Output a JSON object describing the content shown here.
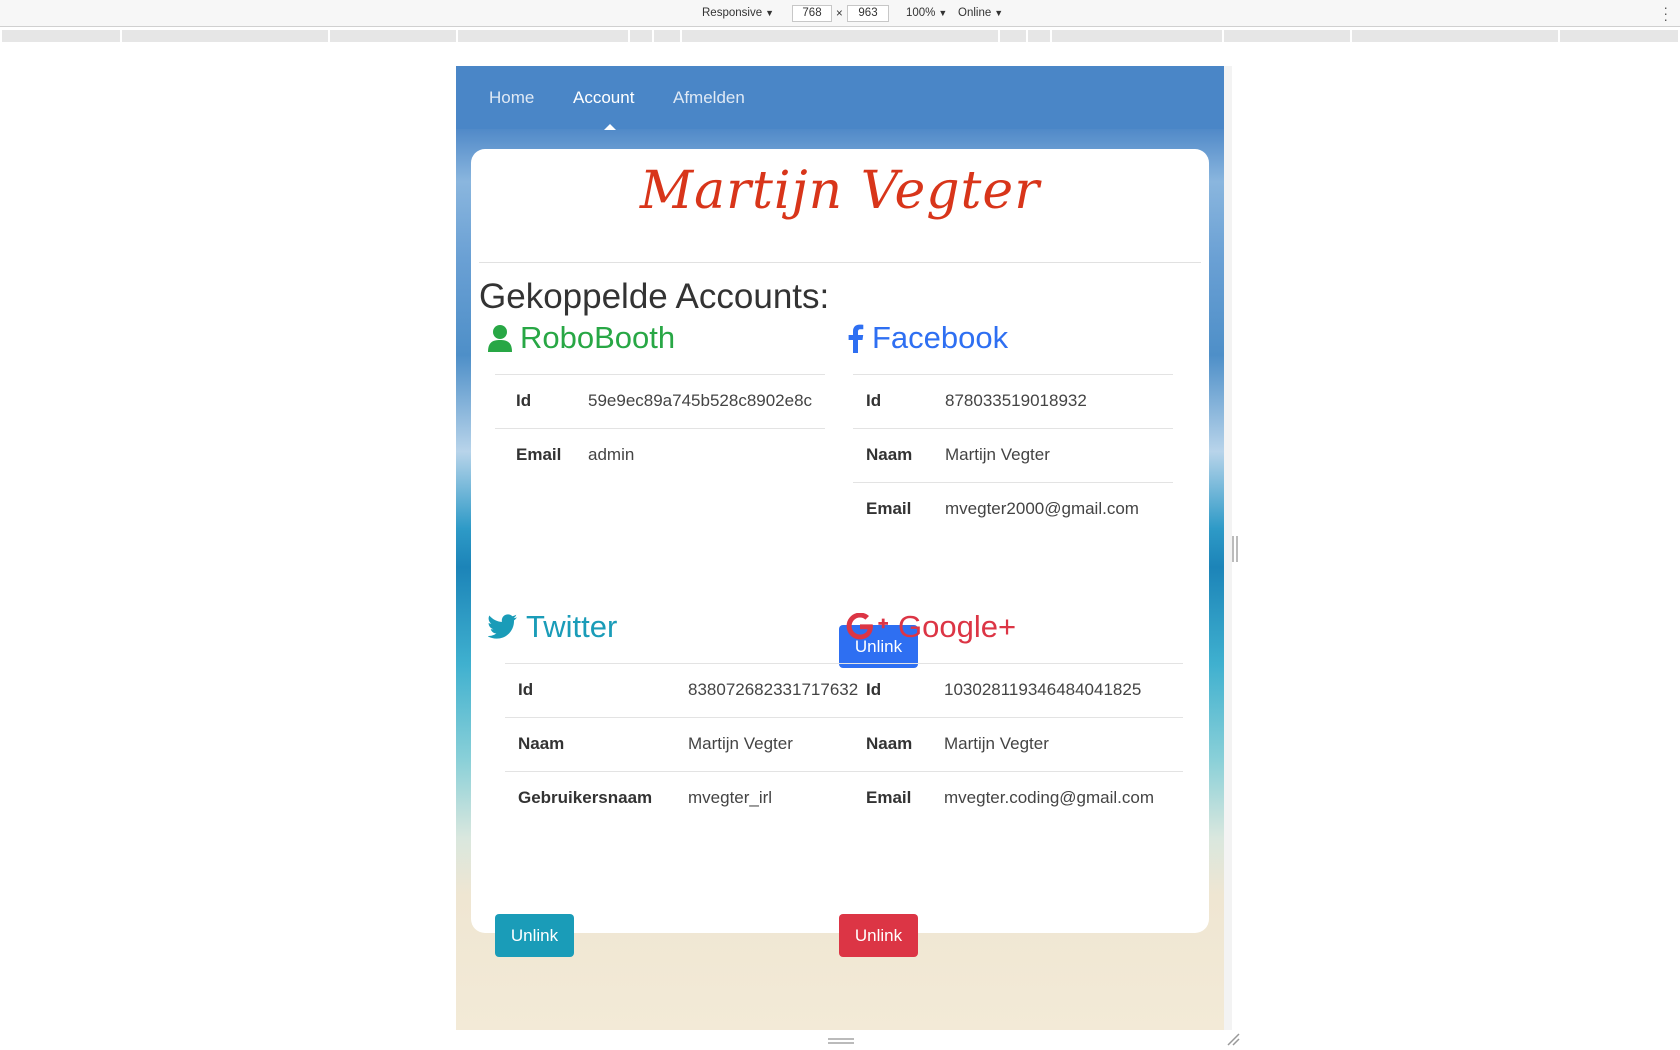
{
  "devtools": {
    "device": "Responsive",
    "width": "768",
    "times": "×",
    "height": "963",
    "zoom": "100%",
    "network": "Online"
  },
  "nav": {
    "items": [
      {
        "label": "Home",
        "active": false
      },
      {
        "label": "Account",
        "active": true
      },
      {
        "label": "Afmelden",
        "active": false
      }
    ]
  },
  "brand": "Martijn Vegter",
  "page_title": "Gekoppelde Accounts:",
  "colors": {
    "robobooth": "#28a745",
    "facebook": "#2e6ff2",
    "twitter": "#1a9cb8",
    "google": "#dc3545",
    "navbar": "#4a86c7",
    "brand": "#d8351a"
  },
  "accounts": {
    "robobooth": {
      "title": "RoboBooth",
      "icon": "user-icon",
      "rows": [
        {
          "key": "Id",
          "value": "59e9ec89a745b528c8902e8c"
        },
        {
          "key": "Email",
          "value": "admin"
        }
      ]
    },
    "facebook": {
      "title": "Facebook",
      "icon": "facebook-icon",
      "rows": [
        {
          "key": "Id",
          "value": "878033519018932"
        },
        {
          "key": "Naam",
          "value": "Martijn Vegter"
        },
        {
          "key": "Email",
          "value": "mvegter2000@gmail.com"
        }
      ],
      "button": "Unlink"
    },
    "twitter": {
      "title": "Twitter",
      "icon": "twitter-icon",
      "rows": [
        {
          "key": "Id",
          "value": "838072682331717632"
        },
        {
          "key": "Naam",
          "value": "Martijn Vegter"
        },
        {
          "key": "Gebruikersnaam",
          "value": "mvegter_irl"
        }
      ],
      "button": "Unlink"
    },
    "google": {
      "title": "Google+",
      "icon": "google-plus-icon",
      "rows": [
        {
          "key": "Id",
          "value": "103028119346484041825"
        },
        {
          "key": "Naam",
          "value": "Martijn Vegter"
        },
        {
          "key": "Email",
          "value": "mvegter.coding@gmail.com"
        }
      ],
      "button": "Unlink"
    }
  }
}
